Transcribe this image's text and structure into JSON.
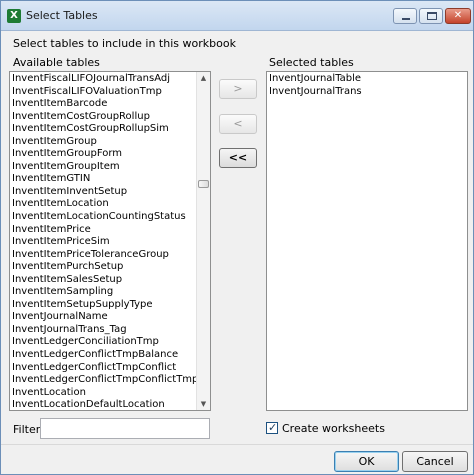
{
  "window": {
    "title": "Select Tables",
    "app_icon_letter": "X"
  },
  "instruction": "Select tables to include in this workbook",
  "available": {
    "label": "Available tables",
    "items": [
      "InventFiscalLIFOJournalTransAdj",
      "InventFiscalLIFOValuationTmp",
      "InventItemBarcode",
      "InventItemCostGroupRollup",
      "InventItemCostGroupRollupSim",
      "InventItemGroup",
      "InventItemGroupForm",
      "InventItemGroupItem",
      "InventItemGTIN",
      "InventItemInventSetup",
      "InventItemLocation",
      "InventItemLocationCountingStatus",
      "InventItemPrice",
      "InventItemPriceSim",
      "InventItemPriceToleranceGroup",
      "InventItemPurchSetup",
      "InventItemSalesSetup",
      "InventItemSampling",
      "InventItemSetupSupplyType",
      "InventJournalName",
      "InventJournalTrans_Tag",
      "InventLedgerConciliationTmp",
      "InventLedgerConflictTmpBalance",
      "InventLedgerConflictTmpConflict",
      "InventLedgerConflictTmpConflictTmp",
      "InventLocation",
      "InventLocationDefaultLocation"
    ]
  },
  "selected": {
    "label": "Selected tables",
    "items": [
      "InventJournalTable",
      "InventJournalTrans"
    ]
  },
  "buttons": {
    "add": ">",
    "remove": "<",
    "remove_all": "<<",
    "ok": "OK",
    "cancel": "Cancel"
  },
  "filter": {
    "label": "Filter:",
    "value": ""
  },
  "create_worksheets": {
    "label": "Create worksheets",
    "checked": true
  },
  "scrollbar": {
    "up_glyph": "▲",
    "down_glyph": "▼"
  },
  "window_buttons": {
    "close_glyph": "✕"
  },
  "colors": {
    "titlebar": "#c2d6ee",
    "ok_focus": "#3c7fb1",
    "close_button": "#c4432b"
  }
}
